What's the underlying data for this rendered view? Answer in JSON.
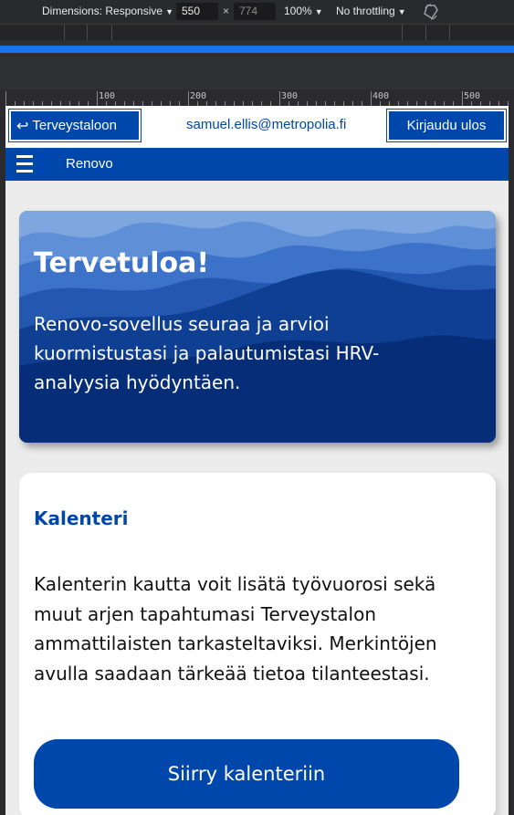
{
  "devtools": {
    "dimensions_label": "Dimensions: Responsive",
    "width_value": "550",
    "height_value": "774",
    "times": "×",
    "zoom": "100%",
    "throttling": "No throttling",
    "ruler_labels": [
      "100",
      "200",
      "300",
      "400",
      "500"
    ],
    "accent_color": "#1a73e8"
  },
  "app": {
    "back_link": "Terveystaloon",
    "back_icon": "return-arrow-icon",
    "user_email": "samuel.ellis@metropolia.fi",
    "logout_label": "Kirjaudu ulos",
    "nav_title": "Renovo",
    "brand_color": "#0047ab"
  },
  "hero": {
    "title": "Tervetuloa!",
    "text": "Renovo-sovellus seuraa ja arvioi kuormistustasi ja palautumistasi HRV-analyysia hyödyntäen."
  },
  "calendar_card": {
    "title": "Kalenteri",
    "text": "Kalenterin kautta voit lisätä työvuorosi sekä muut arjen tapahtumasi Terveystalon ammattilaisten tarkasteltaviksi. Merkintöjen avulla saadaan tärkeää tietoa tilanteestasi.",
    "button_label": "Siirry kalenteriin"
  }
}
